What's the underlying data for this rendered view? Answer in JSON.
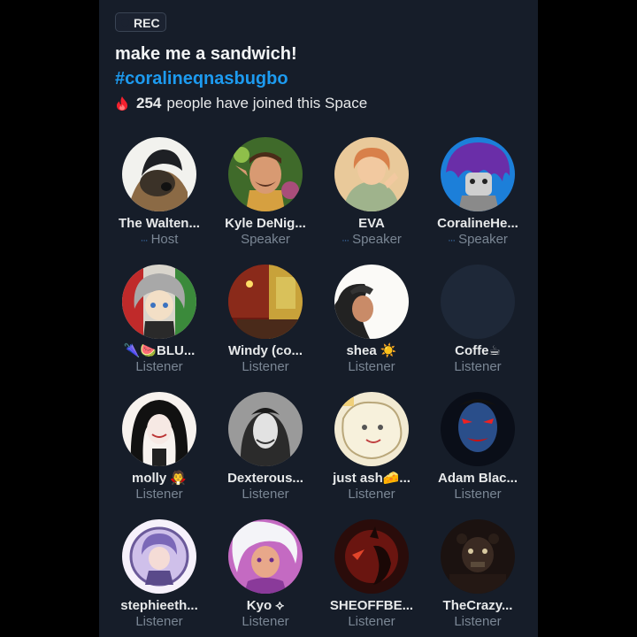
{
  "space": {
    "rec_label": "REC",
    "title": "make me a sandwich!",
    "hashtag": "#coralineqnasbugbo",
    "joined_count": "254",
    "joined_text": "people have joined this Space"
  },
  "participants": [
    {
      "name": "The Walten...",
      "role": "Host",
      "role_icon": "···",
      "avatar": "dog-mask"
    },
    {
      "name": "Kyle DeNig...",
      "role": "Speaker",
      "avatar": "green-elf"
    },
    {
      "name": "EVA",
      "role": "Speaker",
      "role_icon": "···",
      "avatar": "orange-girl"
    },
    {
      "name": "CoralineHe...",
      "role": "Speaker",
      "role_icon": "···",
      "avatar": "purple-hair"
    },
    {
      "name": "🌂🍉BLU...",
      "role": "Listener",
      "avatar": "grey-hair"
    },
    {
      "name": "Windy (co...",
      "role": "Listener",
      "avatar": "red-room"
    },
    {
      "name": "shea ☀️",
      "role": "Listener",
      "avatar": "white-sketch"
    },
    {
      "name": "Coffe☕",
      "role": "Listener",
      "avatar": "blank"
    },
    {
      "name": "molly 🧛",
      "role": "Listener",
      "avatar": "black-hair"
    },
    {
      "name": "Dexterous...",
      "role": "Listener",
      "avatar": "grey-portrait"
    },
    {
      "name": "just ash🧀...",
      "role": "Listener",
      "avatar": "cream-drawing"
    },
    {
      "name": "Adam Blac...",
      "role": "Listener",
      "avatar": "blue-face"
    },
    {
      "name": "stephieeth...",
      "role": "Listener",
      "avatar": "purple-girl"
    },
    {
      "name": "Kyo ⟡",
      "role": "Listener",
      "avatar": "pink-anime"
    },
    {
      "name": "SHEOFFBE...",
      "role": "Listener",
      "avatar": "red-silhouette"
    },
    {
      "name": "TheCrazy...",
      "role": "Listener",
      "avatar": "dark-animatronic"
    }
  ],
  "colors": {
    "background": "#161d29",
    "accent": "#1d9bf0",
    "text": "#e7e9ea",
    "muted": "#7a8694",
    "fire": "#f4212e"
  }
}
